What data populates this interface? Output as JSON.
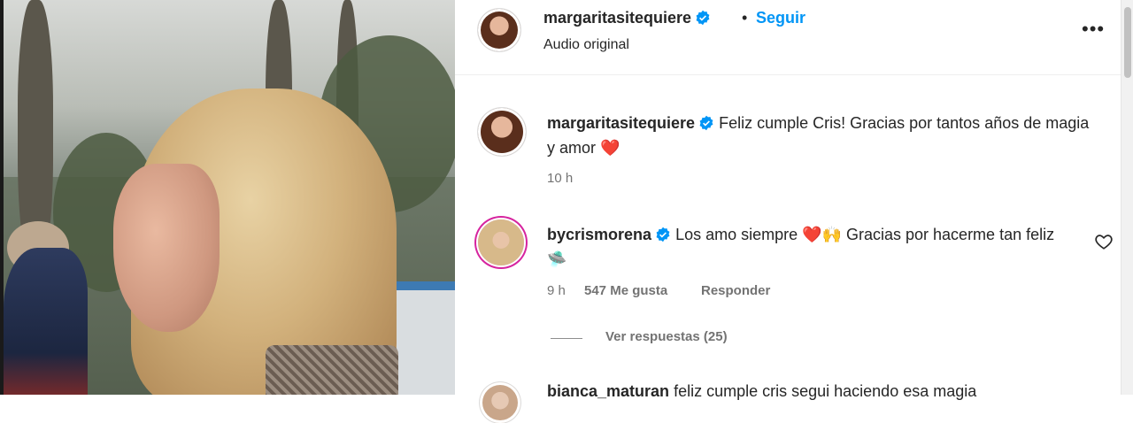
{
  "post": {
    "author": "margaritasitequiere",
    "follow_label": "Seguir",
    "separator": "•",
    "audio": "Audio original",
    "more_label": "•••"
  },
  "caption": {
    "username": "margaritasitequiere",
    "text": "Feliz cumple Cris! Gracias por tantos años de magia y amor",
    "emoji": "❤️",
    "time": "10 h"
  },
  "comments": [
    {
      "username": "bycrismorena",
      "text_a": "Los amo siempre",
      "emoji_a": "❤️🙌",
      "text_b": "Gracias por hacerme tan feliz",
      "emoji_b": "🛸",
      "time": "9 h",
      "likes": "547 Me gusta",
      "reply_label": "Responder",
      "view_replies": "Ver respuestas (25)"
    },
    {
      "username": "bianca_maturan",
      "text": "feliz cumple cris segui haciendo esa magia"
    }
  ],
  "colors": {
    "accent": "#0095f6",
    "verified": "#0095f6",
    "heart": "#e0245e"
  },
  "icons": [
    "verified-badge-icon",
    "more-options-icon",
    "heart-like-icon"
  ]
}
